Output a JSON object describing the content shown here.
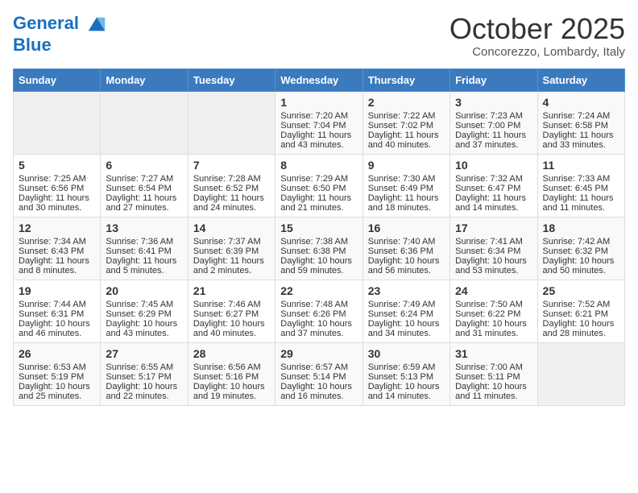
{
  "header": {
    "logo_line1": "General",
    "logo_line2": "Blue",
    "month": "October 2025",
    "location": "Concorezzo, Lombardy, Italy"
  },
  "days_of_week": [
    "Sunday",
    "Monday",
    "Tuesday",
    "Wednesday",
    "Thursday",
    "Friday",
    "Saturday"
  ],
  "weeks": [
    [
      {
        "day": "",
        "data": ""
      },
      {
        "day": "",
        "data": ""
      },
      {
        "day": "",
        "data": ""
      },
      {
        "day": "1",
        "data": "Sunrise: 7:20 AM\nSunset: 7:04 PM\nDaylight: 11 hours and 43 minutes."
      },
      {
        "day": "2",
        "data": "Sunrise: 7:22 AM\nSunset: 7:02 PM\nDaylight: 11 hours and 40 minutes."
      },
      {
        "day": "3",
        "data": "Sunrise: 7:23 AM\nSunset: 7:00 PM\nDaylight: 11 hours and 37 minutes."
      },
      {
        "day": "4",
        "data": "Sunrise: 7:24 AM\nSunset: 6:58 PM\nDaylight: 11 hours and 33 minutes."
      }
    ],
    [
      {
        "day": "5",
        "data": "Sunrise: 7:25 AM\nSunset: 6:56 PM\nDaylight: 11 hours and 30 minutes."
      },
      {
        "day": "6",
        "data": "Sunrise: 7:27 AM\nSunset: 6:54 PM\nDaylight: 11 hours and 27 minutes."
      },
      {
        "day": "7",
        "data": "Sunrise: 7:28 AM\nSunset: 6:52 PM\nDaylight: 11 hours and 24 minutes."
      },
      {
        "day": "8",
        "data": "Sunrise: 7:29 AM\nSunset: 6:50 PM\nDaylight: 11 hours and 21 minutes."
      },
      {
        "day": "9",
        "data": "Sunrise: 7:30 AM\nSunset: 6:49 PM\nDaylight: 11 hours and 18 minutes."
      },
      {
        "day": "10",
        "data": "Sunrise: 7:32 AM\nSunset: 6:47 PM\nDaylight: 11 hours and 14 minutes."
      },
      {
        "day": "11",
        "data": "Sunrise: 7:33 AM\nSunset: 6:45 PM\nDaylight: 11 hours and 11 minutes."
      }
    ],
    [
      {
        "day": "12",
        "data": "Sunrise: 7:34 AM\nSunset: 6:43 PM\nDaylight: 11 hours and 8 minutes."
      },
      {
        "day": "13",
        "data": "Sunrise: 7:36 AM\nSunset: 6:41 PM\nDaylight: 11 hours and 5 minutes."
      },
      {
        "day": "14",
        "data": "Sunrise: 7:37 AM\nSunset: 6:39 PM\nDaylight: 11 hours and 2 minutes."
      },
      {
        "day": "15",
        "data": "Sunrise: 7:38 AM\nSunset: 6:38 PM\nDaylight: 10 hours and 59 minutes."
      },
      {
        "day": "16",
        "data": "Sunrise: 7:40 AM\nSunset: 6:36 PM\nDaylight: 10 hours and 56 minutes."
      },
      {
        "day": "17",
        "data": "Sunrise: 7:41 AM\nSunset: 6:34 PM\nDaylight: 10 hours and 53 minutes."
      },
      {
        "day": "18",
        "data": "Sunrise: 7:42 AM\nSunset: 6:32 PM\nDaylight: 10 hours and 50 minutes."
      }
    ],
    [
      {
        "day": "19",
        "data": "Sunrise: 7:44 AM\nSunset: 6:31 PM\nDaylight: 10 hours and 46 minutes."
      },
      {
        "day": "20",
        "data": "Sunrise: 7:45 AM\nSunset: 6:29 PM\nDaylight: 10 hours and 43 minutes."
      },
      {
        "day": "21",
        "data": "Sunrise: 7:46 AM\nSunset: 6:27 PM\nDaylight: 10 hours and 40 minutes."
      },
      {
        "day": "22",
        "data": "Sunrise: 7:48 AM\nSunset: 6:26 PM\nDaylight: 10 hours and 37 minutes."
      },
      {
        "day": "23",
        "data": "Sunrise: 7:49 AM\nSunset: 6:24 PM\nDaylight: 10 hours and 34 minutes."
      },
      {
        "day": "24",
        "data": "Sunrise: 7:50 AM\nSunset: 6:22 PM\nDaylight: 10 hours and 31 minutes."
      },
      {
        "day": "25",
        "data": "Sunrise: 7:52 AM\nSunset: 6:21 PM\nDaylight: 10 hours and 28 minutes."
      }
    ],
    [
      {
        "day": "26",
        "data": "Sunrise: 6:53 AM\nSunset: 5:19 PM\nDaylight: 10 hours and 25 minutes."
      },
      {
        "day": "27",
        "data": "Sunrise: 6:55 AM\nSunset: 5:17 PM\nDaylight: 10 hours and 22 minutes."
      },
      {
        "day": "28",
        "data": "Sunrise: 6:56 AM\nSunset: 5:16 PM\nDaylight: 10 hours and 19 minutes."
      },
      {
        "day": "29",
        "data": "Sunrise: 6:57 AM\nSunset: 5:14 PM\nDaylight: 10 hours and 16 minutes."
      },
      {
        "day": "30",
        "data": "Sunrise: 6:59 AM\nSunset: 5:13 PM\nDaylight: 10 hours and 14 minutes."
      },
      {
        "day": "31",
        "data": "Sunrise: 7:00 AM\nSunset: 5:11 PM\nDaylight: 10 hours and 11 minutes."
      },
      {
        "day": "",
        "data": ""
      }
    ]
  ]
}
